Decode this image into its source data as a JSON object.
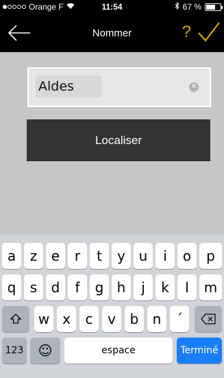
{
  "status_bar": {
    "carrier": "Orange F",
    "time": "11:54",
    "battery_percent_label": "67 %",
    "battery_level": 0.67
  },
  "nav": {
    "title": "Nommer",
    "help_label": "?",
    "accent_color": "#d9a300"
  },
  "form": {
    "name_value": "Aldes",
    "localize_label": "Localiser"
  },
  "keyboard": {
    "row1": [
      "a",
      "z",
      "e",
      "r",
      "t",
      "y",
      "u",
      "i",
      "o",
      "p"
    ],
    "row2": [
      "q",
      "s",
      "d",
      "f",
      "g",
      "h",
      "j",
      "k",
      "l",
      "m"
    ],
    "row3": [
      "w",
      "x",
      "c",
      "v",
      "b",
      "n",
      "´"
    ],
    "numbers_label": "123",
    "emoji_label": "☺",
    "space_label": "espace",
    "done_label": "Terminé",
    "shift_icon": "shift-icon",
    "backspace_icon": "backspace-icon"
  }
}
